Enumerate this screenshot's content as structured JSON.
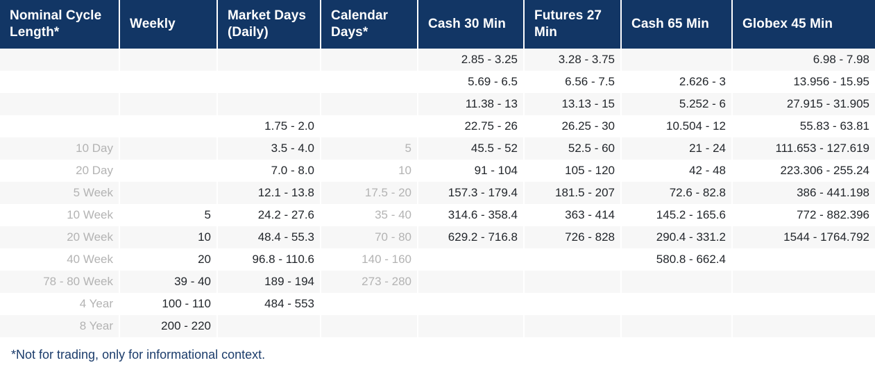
{
  "table": {
    "columns": [
      {
        "key": "nominal",
        "label": "Nominal Cycle Length*",
        "muted": true
      },
      {
        "key": "weekly",
        "label": "Weekly",
        "muted": false
      },
      {
        "key": "market",
        "label": "Market Days (Daily)",
        "muted": false
      },
      {
        "key": "calendar",
        "label": "Calendar Days*",
        "muted": true
      },
      {
        "key": "cash30",
        "label": "Cash 30 Min",
        "muted": false
      },
      {
        "key": "futures27",
        "label": "Futures 27 Min",
        "muted": false
      },
      {
        "key": "cash65",
        "label": "Cash 65 Min",
        "muted": false
      },
      {
        "key": "globex45",
        "label": "Globex 45 Min",
        "muted": false
      }
    ],
    "rows": [
      {
        "nominal": "",
        "weekly": "",
        "market": "",
        "calendar": "",
        "cash30": "2.85 - 3.25",
        "futures27": "3.28 - 3.75",
        "cash65": "",
        "globex45": "6.98 - 7.98"
      },
      {
        "nominal": "",
        "weekly": "",
        "market": "",
        "calendar": "",
        "cash30": "5.69 - 6.5",
        "futures27": "6.56 - 7.5",
        "cash65": "2.626 - 3",
        "globex45": "13.956 - 15.95"
      },
      {
        "nominal": "",
        "weekly": "",
        "market": "",
        "calendar": "",
        "cash30": "11.38 - 13",
        "futures27": "13.13 - 15",
        "cash65": "5.252 - 6",
        "globex45": "27.915 - 31.905"
      },
      {
        "nominal": "",
        "weekly": "",
        "market": "1.75 - 2.0",
        "calendar": "",
        "cash30": "22.75 - 26",
        "futures27": "26.25 - 30",
        "cash65": "10.504 - 12",
        "globex45": "55.83 - 63.81"
      },
      {
        "nominal": "10 Day",
        "weekly": "",
        "market": "3.5 - 4.0",
        "calendar": "5",
        "cash30": "45.5 - 52",
        "futures27": "52.5 - 60",
        "cash65": "21 - 24",
        "globex45": "111.653 - 127.619"
      },
      {
        "nominal": "20 Day",
        "weekly": "",
        "market": "7.0 - 8.0",
        "calendar": "10",
        "cash30": "91 - 104",
        "futures27": "105 - 120",
        "cash65": "42 - 48",
        "globex45": "223.306 - 255.24"
      },
      {
        "nominal": "5 Week",
        "weekly": "",
        "market": "12.1 - 13.8",
        "calendar": "17.5 - 20",
        "cash30": "157.3 - 179.4",
        "futures27": "181.5 - 207",
        "cash65": "72.6 - 82.8",
        "globex45": "386 - 441.198"
      },
      {
        "nominal": "10 Week",
        "weekly": "5",
        "market": "24.2 - 27.6",
        "calendar": "35 - 40",
        "cash30": "314.6 - 358.4",
        "futures27": "363 - 414",
        "cash65": "145.2 - 165.6",
        "globex45": "772 - 882.396"
      },
      {
        "nominal": "20 Week",
        "weekly": "10",
        "market": "48.4 - 55.3",
        "calendar": "70 - 80",
        "cash30": "629.2 - 716.8",
        "futures27": "726 - 828",
        "cash65": "290.4 - 331.2",
        "globex45": "1544 - 1764.792"
      },
      {
        "nominal": "40 Week",
        "weekly": "20",
        "market": "96.8 - 110.6",
        "calendar": "140 - 160",
        "cash30": "",
        "futures27": "",
        "cash65": "580.8 - 662.4",
        "globex45": ""
      },
      {
        "nominal": "78 - 80 Week",
        "weekly": "39 - 40",
        "market": "189 - 194",
        "calendar": "273 - 280",
        "cash30": "",
        "futures27": "",
        "cash65": "",
        "globex45": ""
      },
      {
        "nominal": "4 Year",
        "weekly": "100 - 110",
        "market": "484 - 553",
        "calendar": "",
        "cash30": "",
        "futures27": "",
        "cash65": "",
        "globex45": ""
      },
      {
        "nominal": "8 Year",
        "weekly": "200 - 220",
        "market": "",
        "calendar": "",
        "cash30": "",
        "futures27": "",
        "cash65": "",
        "globex45": ""
      }
    ]
  },
  "footnote": "*Not for trading, only for informational context.",
  "colors": {
    "header_background": "#123665",
    "header_text": "#ffffff",
    "row_stripe": "#f7f7f7",
    "row_plain": "#ffffff",
    "cell_text": "#22262b",
    "muted_text": "#b3b3b3",
    "footnote_text": "#1b3c6b"
  }
}
